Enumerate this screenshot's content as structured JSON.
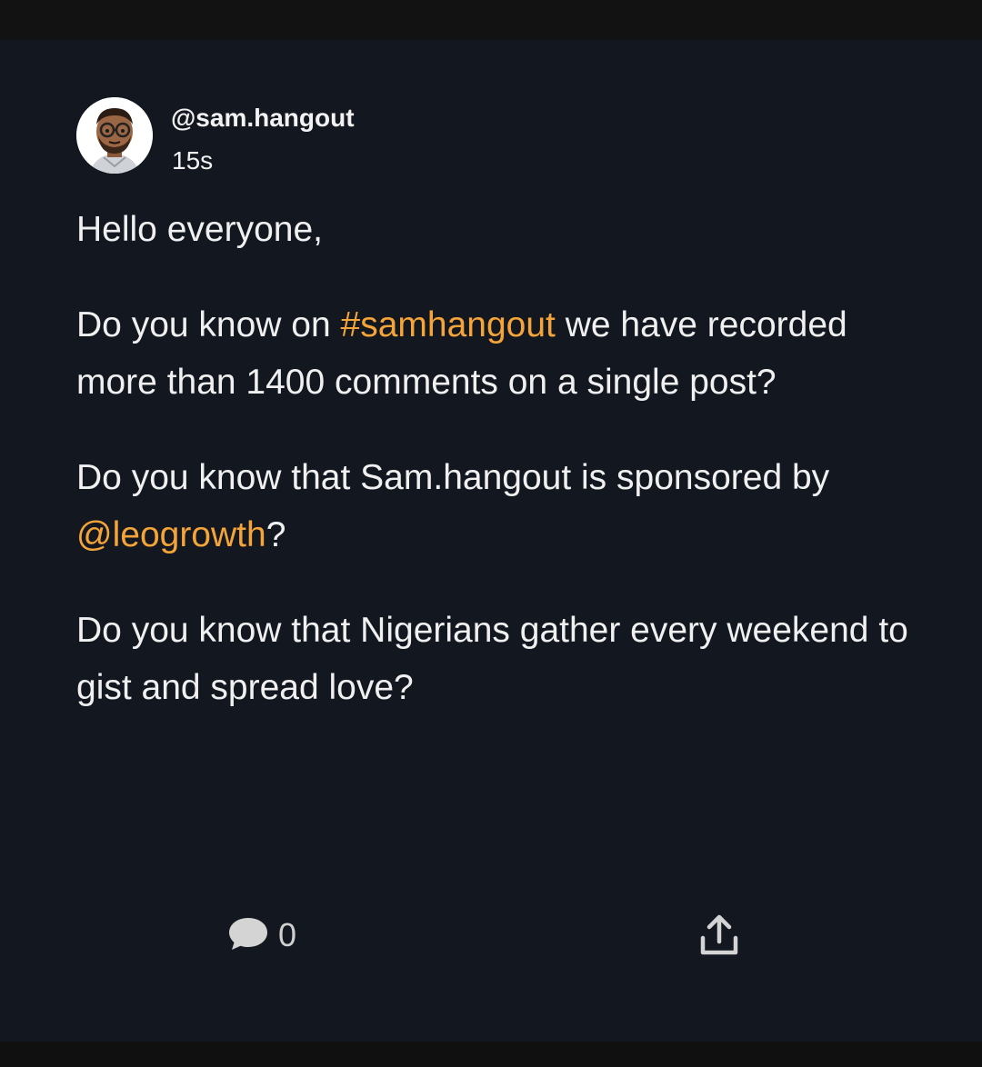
{
  "post": {
    "username": "@sam.hangout",
    "time": "15s",
    "greeting": "Hello everyone,",
    "p1_before": "Do you know on ",
    "p1_hashtag": "#samhangout",
    "p1_after": " we have recorded more than 1400 comments on a single post?",
    "p2_before": "Do you know that Sam.hangout is sponsored by ",
    "p2_mention": "@leogrowth",
    "p2_after": "?",
    "p3": "Do you know that Nigerians gather every weekend to gist and spread love?"
  },
  "actions": {
    "comment_count": "0",
    "comment_icon": "chat-bubble-icon",
    "share_icon": "share-upload-icon"
  },
  "colors": {
    "background": "#131820",
    "text": "#f0f0f0",
    "accent": "#f5a43a"
  }
}
